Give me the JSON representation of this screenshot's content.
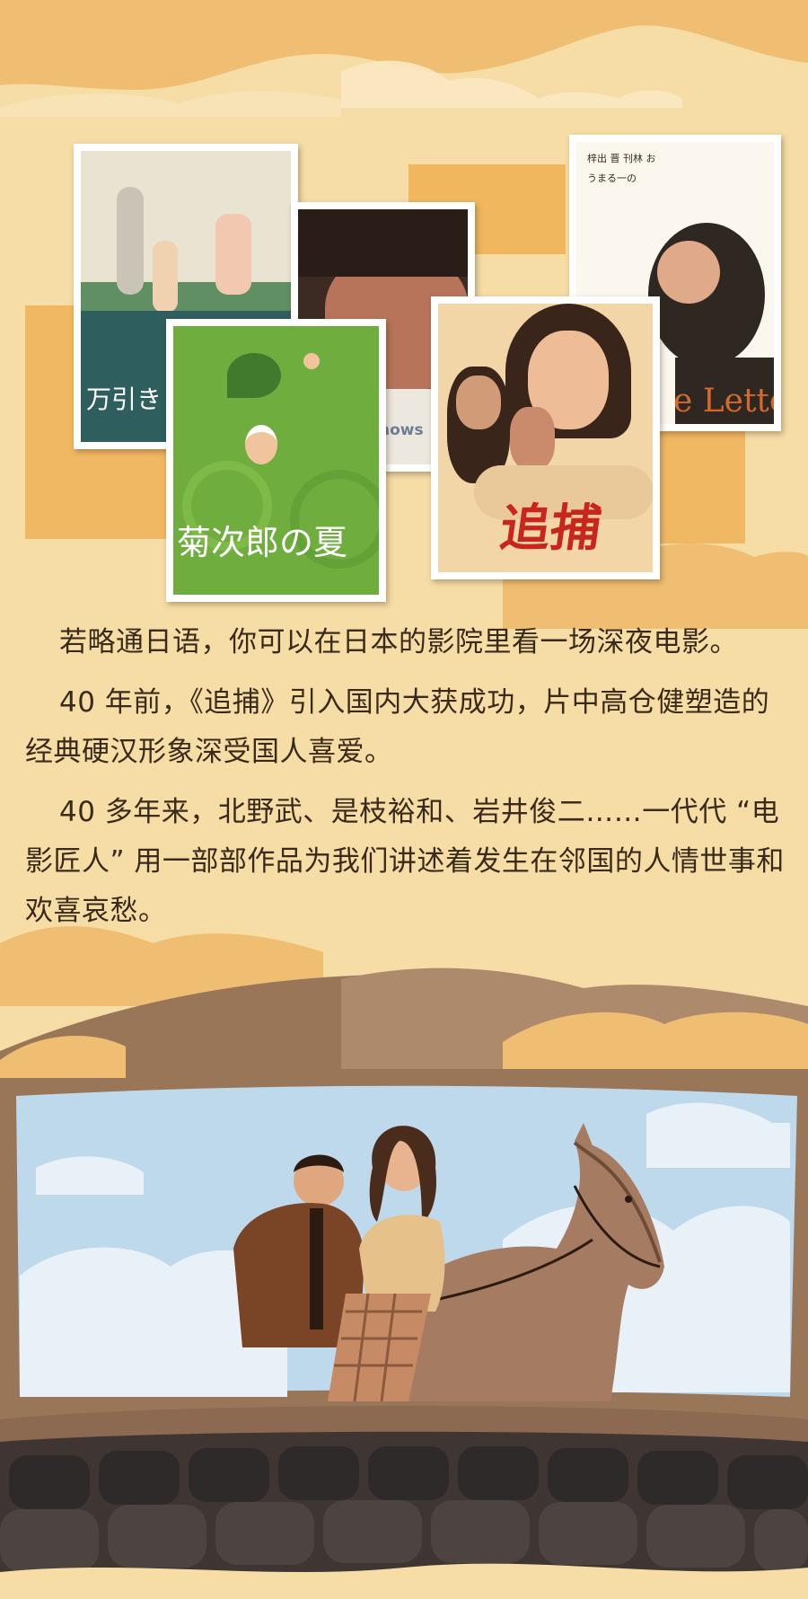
{
  "posters": [
    {
      "name": "poster-manbiki",
      "title": "万引き"
    },
    {
      "name": "poster-shadows",
      "title": "hows"
    },
    {
      "name": "poster-kikujiro",
      "title": "菊次郎の夏"
    },
    {
      "name": "poster-love-letter",
      "title": "e Letter",
      "vertical_text": "梓出 晋 刊林 おうまる一の"
    },
    {
      "name": "poster-zhuibu",
      "title": "追捕"
    }
  ],
  "article": {
    "p1": "若略通日语，你可以在日本的影院里看一场深夜电影。",
    "p2": "40 年前，《追捕》引入国内大获成功，片中高仓健塑造的经典硬汉形象深受国人喜爱。",
    "p3": "40 多年来，北野武、是枝裕和、岩井俊二……一代代 “电影匠人” 用一部部作品为我们讲述着发生在邻国的人情世事和欢喜哀愁。"
  },
  "colors": {
    "background": "#f6dca5",
    "cloud": "#f0be72",
    "text": "#3a2a1c",
    "hill": "#9a7659",
    "screen_sky": "#bfd9ec",
    "seats": "#2e2a2a"
  }
}
